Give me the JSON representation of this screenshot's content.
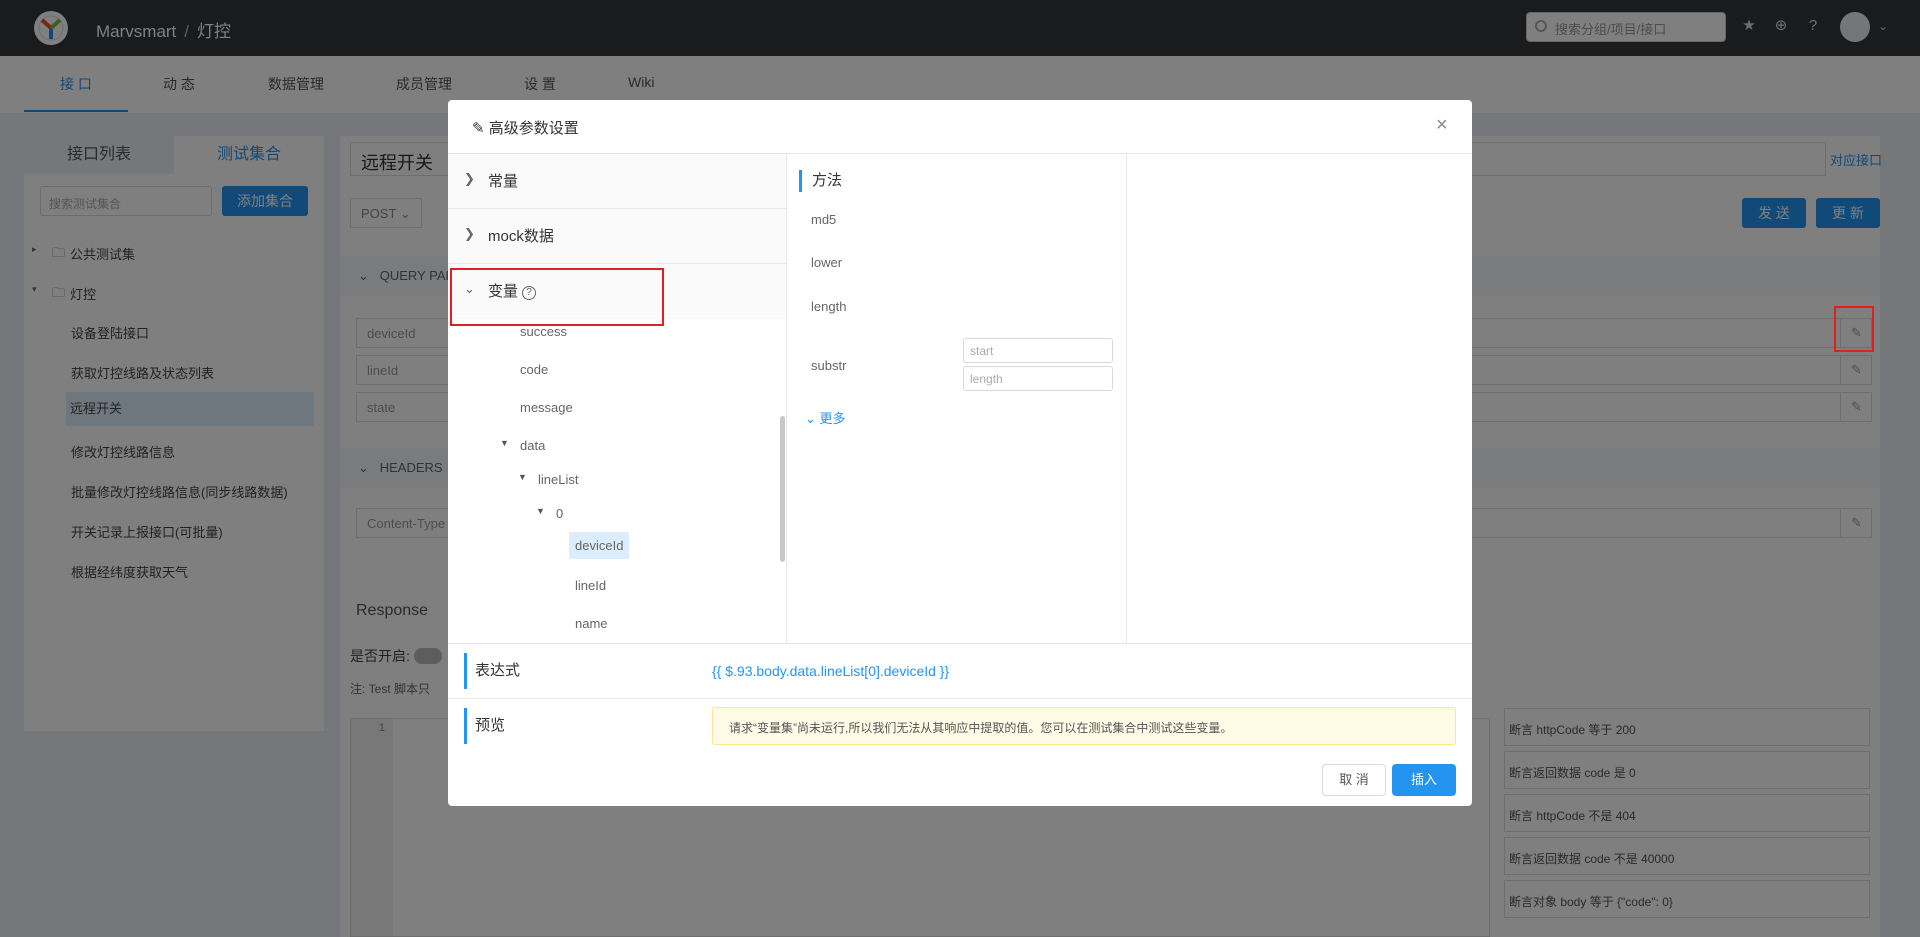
{
  "header": {
    "project": "Marvsmart",
    "separator": "/",
    "group": "灯控",
    "search_placeholder": "搜索分组/项目/接口"
  },
  "tabs": [
    {
      "label": "接 口"
    },
    {
      "label": "动 态"
    },
    {
      "label": "数据管理"
    },
    {
      "label": "成员管理"
    },
    {
      "label": "设 置"
    },
    {
      "label": "Wiki"
    }
  ],
  "sidebar": {
    "tab_list": "接口列表",
    "tab_collection": "测试集合",
    "search_placeholder": "搜索测试集合",
    "add_button": "添加集合",
    "folders": [
      {
        "label": "公共测试集"
      },
      {
        "label": "灯控"
      }
    ],
    "items": [
      {
        "label": "设备登陆接口"
      },
      {
        "label": "获取灯控线路及状态列表"
      },
      {
        "label": "远程开关"
      },
      {
        "label": "修改灯控线路信息"
      },
      {
        "label": "批量修改灯控线路信息(同步线路数据)"
      },
      {
        "label": "开关记录上报接口(可批量)"
      },
      {
        "label": "根据经纬度获取天气"
      }
    ]
  },
  "main": {
    "title": "远程开关",
    "link": "对应接口",
    "method": "POST",
    "send": "发 送",
    "update": "更 新",
    "query_section": "QUERY PAR",
    "query_params": [
      "deviceId",
      "lineId",
      "state"
    ],
    "headers_section": "HEADERS",
    "header_params": [
      "Content-Type"
    ],
    "response": "Response",
    "toggle_label": "是否开启:",
    "note": "注: Test 脚本只",
    "editor_line": "1",
    "assertions": [
      "断言 httpCode 等于 200",
      "断言返回数据 code 是 0",
      "断言 httpCode 不是 404",
      "断言返回数据 code 不是 40000",
      "断言对象 body 等于 {\"code\": 0}"
    ]
  },
  "modal": {
    "title": "高级参数设置",
    "panels": {
      "constants": "常量",
      "mock": "mock数据",
      "variables": "变量"
    },
    "var_tree": {
      "success": "success",
      "code": "code",
      "message": "message",
      "data": "data",
      "lineList": "lineList",
      "index0": "0",
      "deviceId": "deviceId",
      "lineId": "lineId",
      "name": "name"
    },
    "methods": {
      "title": "方法",
      "md5": "md5",
      "lower": "lower",
      "length": "length",
      "substr": "substr",
      "start_placeholder": "start",
      "length_placeholder": "length",
      "more": "更多"
    },
    "expression_label": "表达式",
    "expression_value": "{{ $.93.body.data.lineList[0].deviceId }}",
    "preview_label": "预览",
    "preview_text": "请求“变量集”尚未运行,所以我们无法从其响应中提取的值。您可以在测试集合中测试这些变量。",
    "cancel": "取 消",
    "insert": "插入"
  }
}
